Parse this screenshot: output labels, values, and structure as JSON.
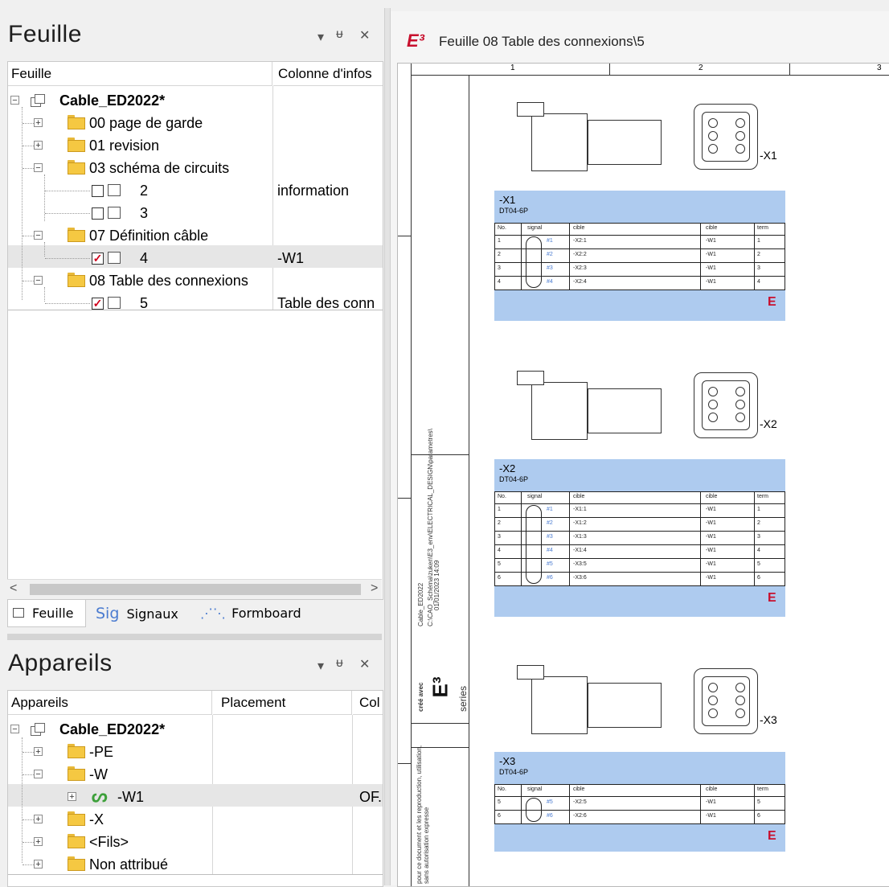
{
  "sheet_panel": {
    "title": "Feuille",
    "col_sheet": "Feuille",
    "col_info": "Colonne d'infos",
    "root": "Cable_ED2022*",
    "items": [
      {
        "label": "00 page de garde",
        "info": ""
      },
      {
        "label": "01 revision",
        "info": ""
      },
      {
        "label": "03 schéma de circuits",
        "info": ""
      },
      {
        "label": "2",
        "info": "information"
      },
      {
        "label": "3",
        "info": ""
      },
      {
        "label": "07 Définition câble",
        "info": ""
      },
      {
        "label": "4",
        "info": "-W1"
      },
      {
        "label": "08 Table des connexions",
        "info": ""
      },
      {
        "label": "5",
        "info": "Table des conn"
      }
    ],
    "tabs": {
      "feuille": "Feuille",
      "sig_prefix": "Sig",
      "signaux": "Signaux",
      "formboard": "Formboard"
    }
  },
  "devices_panel": {
    "title": "Appareils",
    "col_devices": "Appareils",
    "col_placement": "Placement",
    "col_col": "Col",
    "root": "Cable_ED2022*",
    "items": [
      {
        "label": "-PE",
        "col": ""
      },
      {
        "label": "-W",
        "col": ""
      },
      {
        "label": "-W1",
        "col": "OF."
      },
      {
        "label": "-X",
        "col": ""
      },
      {
        "label": "<Fils>",
        "col": ""
      },
      {
        "label": "Non attribué",
        "col": ""
      }
    ]
  },
  "controls": {
    "dropdown": "▾",
    "pin": "ᵾ",
    "close": "✕",
    "scroll_left": "<",
    "scroll_right": ">"
  },
  "drawing": {
    "window_title": "Feuille 08 Table des connexions\\5",
    "columns": [
      "1",
      "2",
      "3"
    ],
    "side_text_1": "Cable_ED2022",
    "side_text_2": "C:\\CAO_Schéma\\zuken\\E3_env\\ELECTRICAL_DESIGN\\parametres\\",
    "side_text_3": "01/01/2023 14:09",
    "side_brand_1": "créé avec",
    "side_brand_2": "series",
    "side_legal": "pour ce document et les reproduction, utilisation, sans autorisation expresse",
    "table_headers": {
      "no": "No.",
      "signal": "signal",
      "cible1": "cible",
      "cible2": "cible",
      "term": "term"
    },
    "connectors": [
      {
        "name": "-X1",
        "type": "DT04-6P",
        "label": "-X1",
        "rows": [
          [
            "1",
            "#1",
            "-X2:1",
            "-W1",
            "1"
          ],
          [
            "2",
            "#2",
            "-X2:2",
            "-W1",
            "2"
          ],
          [
            "3",
            "#3",
            "-X2:3",
            "-W1",
            "3"
          ],
          [
            "4",
            "#4",
            "-X2:4",
            "-W1",
            "4"
          ]
        ]
      },
      {
        "name": "-X2",
        "type": "DT04-6P",
        "label": "-X2",
        "rows": [
          [
            "1",
            "#1",
            "-X1:1",
            "-W1",
            "1"
          ],
          [
            "2",
            "#2",
            "-X1:2",
            "-W1",
            "2"
          ],
          [
            "3",
            "#3",
            "-X1:3",
            "-W1",
            "3"
          ],
          [
            "4",
            "#4",
            "-X1:4",
            "-W1",
            "4"
          ],
          [
            "5",
            "#5",
            "-X3:5",
            "-W1",
            "5"
          ],
          [
            "6",
            "#6",
            "-X3:6",
            "-W1",
            "6"
          ]
        ]
      },
      {
        "name": "-X3",
        "type": "DT04-6P",
        "label": "-X3",
        "rows": [
          [
            "5",
            "#5",
            "-X2:5",
            "-W1",
            "5"
          ],
          [
            "6",
            "#6",
            "-X2:6",
            "-W1",
            "6"
          ]
        ]
      }
    ]
  }
}
